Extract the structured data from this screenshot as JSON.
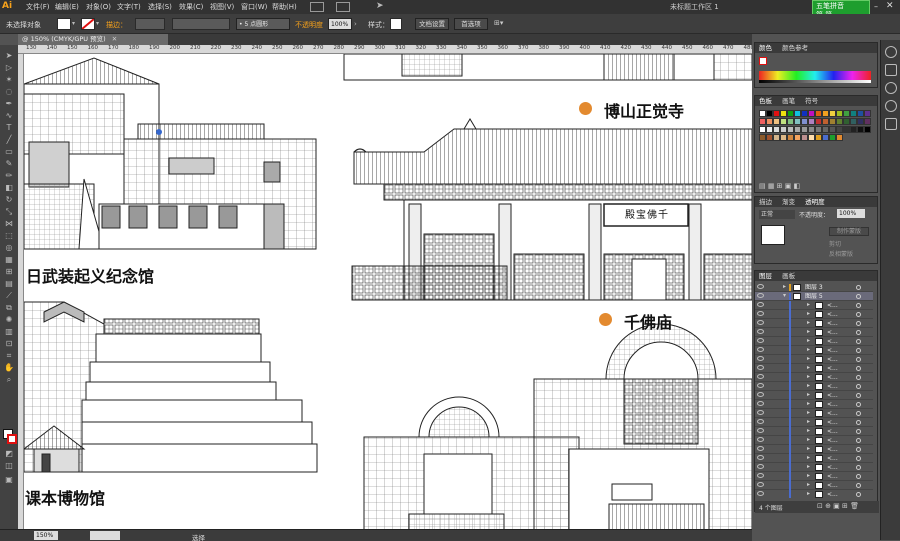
{
  "app": {
    "logo": "Ai",
    "doc_title": "未标题工作区 1",
    "badge_line1": "五笔拼音",
    "badge_line2": "简 简"
  },
  "menus": [
    "文件(F)",
    "编辑(E)",
    "对象(O)",
    "文字(T)",
    "选择(S)",
    "效果(C)",
    "视图(V)",
    "窗口(W)",
    "帮助(H)"
  ],
  "control_bar": {
    "no_selection": "未选择对象",
    "stroke_label": "描边：",
    "brush": "5 点圆形",
    "opacity_label": "不透明度",
    "opacity_value": "100%",
    "style_label": "样式：",
    "doc_setup_button": "文档设置",
    "preferences_button": "首选项"
  },
  "tab": {
    "doc_tab": "@ 150% (CMYK/GPU 预览)"
  },
  "ruler_ticks": [
    "130",
    "140",
    "150",
    "160",
    "170",
    "180",
    "190",
    "200",
    "210",
    "220",
    "230",
    "240",
    "250",
    "260",
    "270",
    "280",
    "290",
    "300",
    "310",
    "320",
    "330",
    "340",
    "350",
    "360",
    "370",
    "380",
    "390",
    "400",
    "410",
    "420",
    "430",
    "440",
    "450",
    "460",
    "470",
    "480"
  ],
  "canvas": {
    "cap_memorial": "日武装起义纪念馆",
    "cap_zhengjue": "博山正觉寺",
    "cap_qianfo": "千佛庙",
    "cap_museum": "国课本博物馆",
    "sign_text": "殿宝佛千"
  },
  "status": {
    "zoom": "150%",
    "tool_name": "选择"
  },
  "color_panel": {
    "tab_color": "颜色",
    "tab_color_guide": "颜色参考"
  },
  "swatch_panel": {
    "tab_swatches": "色板",
    "tab_brushes": "画笔",
    "tab_symbols": "符号"
  },
  "transparency_panel": {
    "tab_stroke": "描边",
    "tab_gradient": "渐变",
    "tab_transparency": "透明度",
    "blend_mode": "正常",
    "opacity_label": "不透明度：",
    "opacity_value": "100%",
    "make_mask": "制作蒙版",
    "clip": "剪切",
    "invert_mask": "反相蒙版"
  },
  "layers_panel": {
    "tab_layers": "图层",
    "tab_artboards": "画板",
    "layer3": "图层 3",
    "layer5": "图层 5",
    "sublayer": "<...",
    "footer_count": "4 个图层"
  },
  "colors": {
    "accent_dot": "#e38a2f",
    "badge_green": "#1e9e2e",
    "logo_orange": "#f7a21b",
    "layer_blue": "#4a6ccf"
  }
}
